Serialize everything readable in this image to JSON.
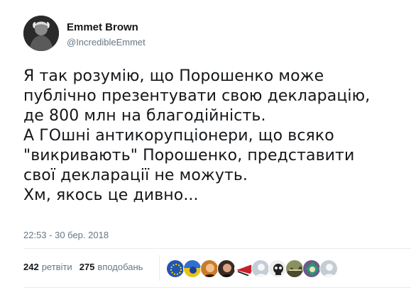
{
  "author": {
    "name": "Emmet Brown",
    "handle": "@IncredibleEmmet",
    "avatar_icon": "profile-photo-icon"
  },
  "tweet": {
    "lines": [
      "Я так розумію, що Порошенко може",
      "публічно презентувати свою декларацію,",
      "де 800 млн на благодійність.",
      "А ГОшні антикорупціонери, що всяко",
      "\"викривають\" Порошенко, представити",
      "свої декларації не можуть.",
      "Хм, якось це дивно..."
    ],
    "timestamp": "22:53 - 30 бер. 2018"
  },
  "stats": {
    "retweets_count": "242",
    "retweets_label": "ретвіти",
    "likes_count": "275",
    "likes_label": "вподобань"
  },
  "likers": [
    {
      "icon": "liker-avatar-icon",
      "color": "#2255b0"
    },
    {
      "icon": "liker-avatar-icon",
      "color": "#e8c21a"
    },
    {
      "icon": "liker-avatar-icon",
      "color": "#c97a2c"
    },
    {
      "icon": "liker-avatar-icon",
      "color": "#3a2a22"
    },
    {
      "icon": "liker-avatar-icon",
      "color": "#c8202a"
    },
    {
      "icon": "liker-avatar-icon",
      "color": "#c4ccd4"
    },
    {
      "icon": "liker-avatar-icon",
      "color": "#222222"
    },
    {
      "icon": "liker-avatar-icon",
      "color": "#8a9060"
    },
    {
      "icon": "liker-avatar-icon",
      "color": "#6a5a8a"
    },
    {
      "icon": "liker-avatar-icon",
      "color": "#c4ccd4"
    }
  ],
  "colors": {
    "text": "#14171a",
    "secondary": "#657786",
    "divider": "#e6ecf0"
  }
}
